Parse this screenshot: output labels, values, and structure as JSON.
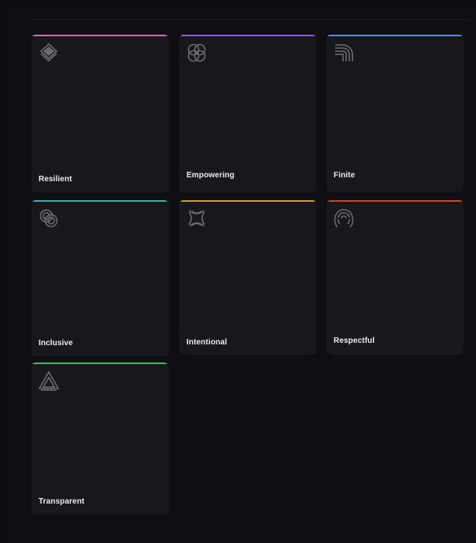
{
  "cards": [
    {
      "label": "Resilient",
      "accent": "#d26ab7",
      "icon": "layered-diamond-icon"
    },
    {
      "label": "Empowering",
      "accent": "#8a5bd6",
      "icon": "interlocking-rings-icon"
    },
    {
      "label": "Finite",
      "accent": "#4f8fd9",
      "icon": "concentric-arcs-icon"
    },
    {
      "label": "Inclusive",
      "accent": "#3fb3ab",
      "icon": "linked-circles-icon"
    },
    {
      "label": "Intentional",
      "accent": "#c8a51f",
      "icon": "converging-arcs-icon"
    },
    {
      "label": "Respectful",
      "accent": "#d2432f",
      "icon": "fan-arcs-icon"
    },
    {
      "label": "Transparent",
      "accent": "#3fb563",
      "icon": "nested-triangle-icon"
    }
  ]
}
